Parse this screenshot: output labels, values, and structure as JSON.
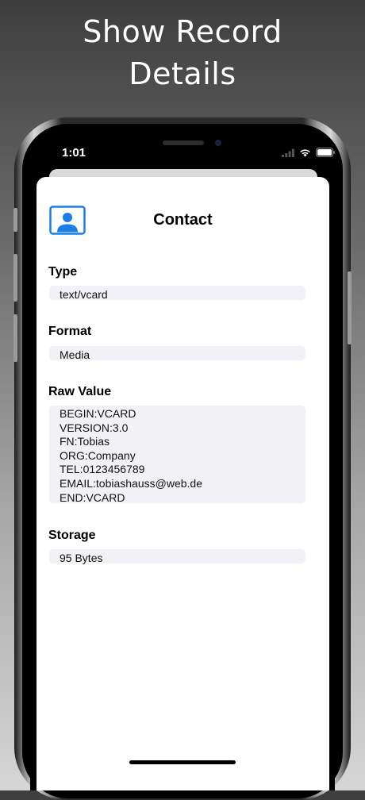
{
  "headline": {
    "line1": "Show Record",
    "line2": "Details"
  },
  "status_bar": {
    "time": "01:01",
    "time_display": "1:01",
    "icons": [
      "signal-icon",
      "wifi-icon",
      "battery-icon"
    ]
  },
  "record": {
    "title": "Contact",
    "icon": "contact-card-icon",
    "sections": {
      "type": {
        "label": "Type",
        "value": "text/vcard"
      },
      "format": {
        "label": "Format",
        "value": "Media"
      },
      "raw": {
        "label": "Raw Value",
        "lines": [
          "BEGIN:VCARD",
          "VERSION:3.0",
          "FN:Tobias",
          "ORG:Company",
          "TEL:0123456789",
          "EMAIL:tobiashauss@web.de",
          "END:VCARD"
        ]
      },
      "storage": {
        "label": "Storage",
        "value": "95 Bytes"
      }
    }
  },
  "colors": {
    "accent": "#1a7ee6",
    "field_background": "#f2f2f6"
  }
}
